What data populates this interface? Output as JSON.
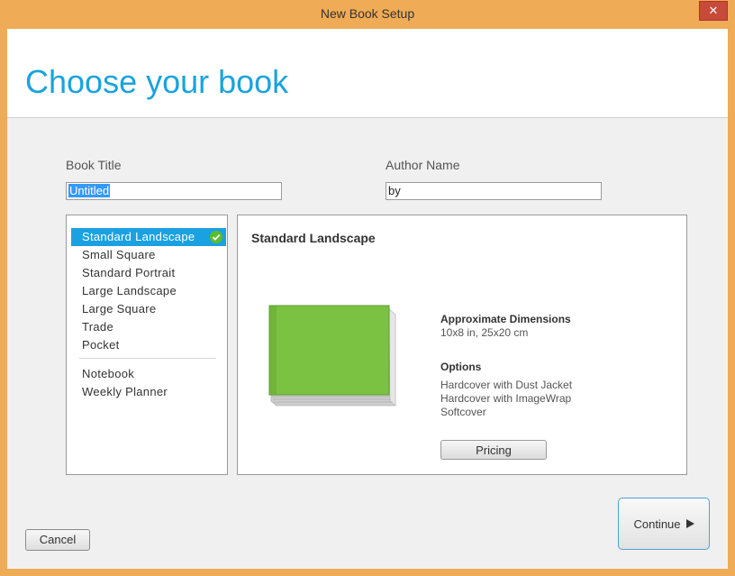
{
  "window": {
    "title": "New Book Setup",
    "close_glyph": "✕"
  },
  "header": {
    "title": "Choose your book"
  },
  "form": {
    "book_title_label": "Book Title",
    "book_title_value": "Untitled",
    "author_label": "Author Name",
    "author_value": "by"
  },
  "book_list": {
    "items": [
      {
        "label": "Standard Landscape",
        "selected": true
      },
      {
        "label": "Small Square"
      },
      {
        "label": "Standard Portrait"
      },
      {
        "label": "Large Landscape"
      },
      {
        "label": "Large Square"
      },
      {
        "label": "Trade"
      },
      {
        "label": "Pocket"
      }
    ],
    "other_items": [
      {
        "label": "Notebook"
      },
      {
        "label": "Weekly Planner"
      }
    ]
  },
  "detail": {
    "title": "Standard Landscape",
    "dimensions_label": "Approximate Dimensions",
    "dimensions_value": "10x8 in, 25x20 cm",
    "options_label": "Options",
    "options": [
      "Hardcover with Dust Jacket",
      "Hardcover with ImageWrap",
      "Softcover"
    ],
    "pricing_label": "Pricing",
    "cover_color": "#7cc242"
  },
  "footer": {
    "cancel_label": "Cancel",
    "continue_label": "Continue"
  },
  "colors": {
    "accent": "#1aa3de",
    "selection": "#1ba1e2",
    "frame": "#efab55",
    "check": "#5bbd2b"
  }
}
